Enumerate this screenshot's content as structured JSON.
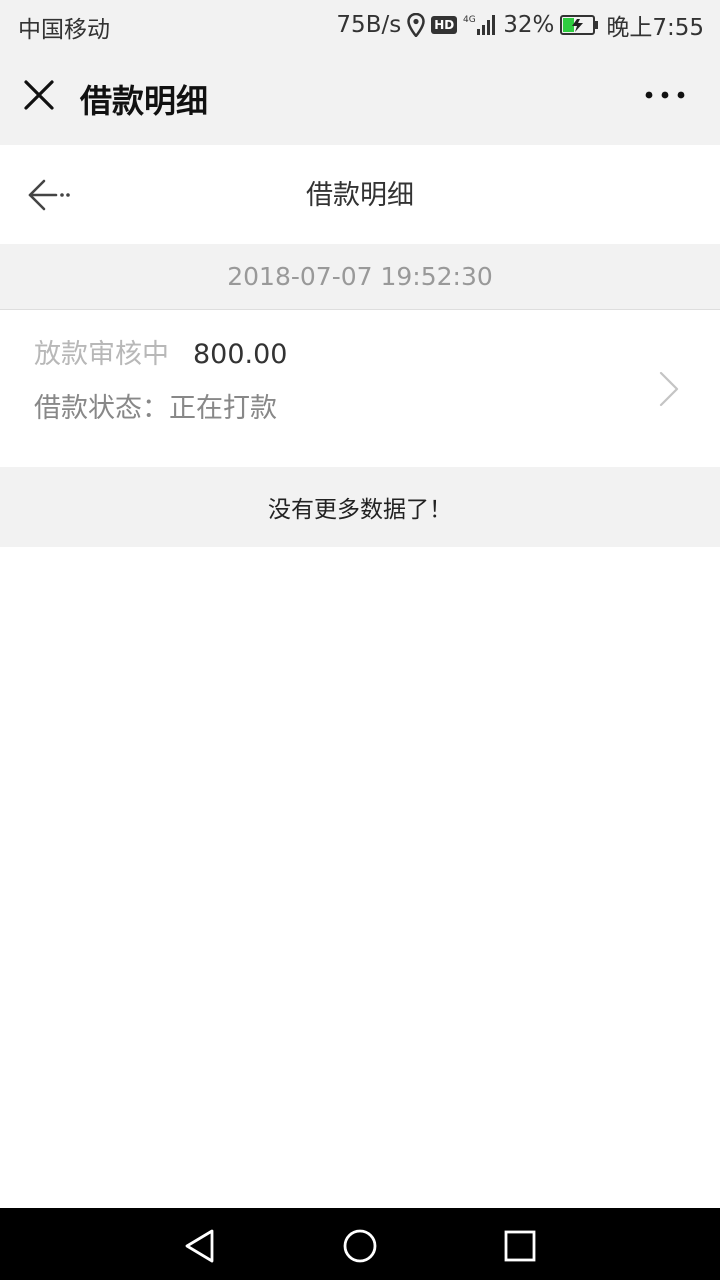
{
  "status_bar": {
    "carrier": "中国移动",
    "net_speed": "75B/s",
    "hd_badge": "HD",
    "network": "4G",
    "battery_percent": "32%",
    "time": "晚上7:55"
  },
  "wechat_bar": {
    "title": "借款明细",
    "close_icon": "close-icon",
    "more_icon": "more-dots-icon"
  },
  "page_header": {
    "title": "借款明细",
    "back_icon": "back-arrow-icon"
  },
  "loan_records": [
    {
      "date": "2018-07-07 19:52:30",
      "status_label": "放款审核中",
      "amount": "800.00",
      "state_text": "借款状态：正在打款"
    }
  ],
  "footer": {
    "message": "没有更多数据了！"
  },
  "nav_bar": {
    "back_icon": "triangle-back-icon",
    "home_icon": "circle-home-icon",
    "recents_icon": "square-recents-icon"
  },
  "colors": {
    "bar_bg": "#f2f2f2",
    "muted_text": "#b8b8b8",
    "nav_bg": "#000000"
  }
}
